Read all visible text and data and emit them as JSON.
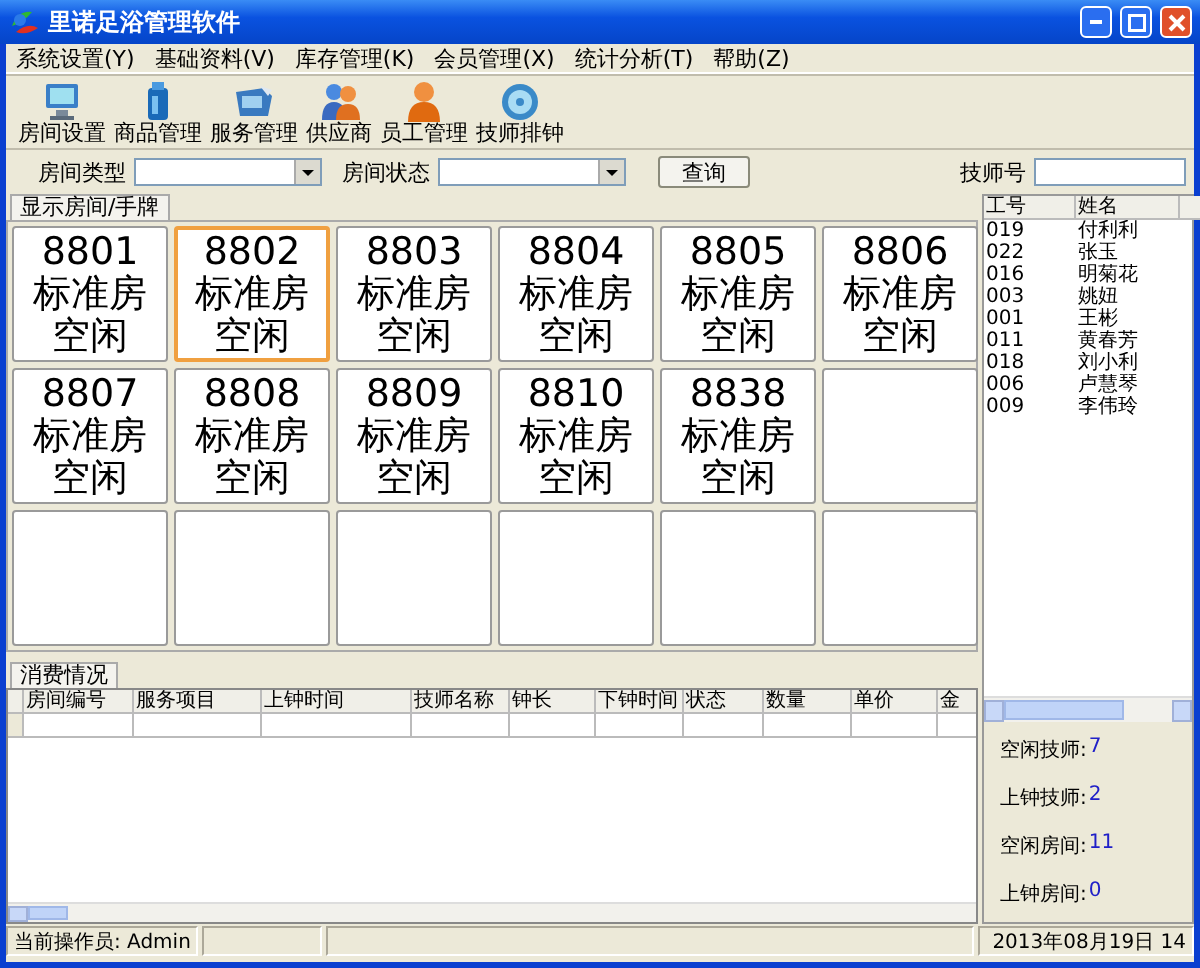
{
  "window": {
    "title": "里诺足浴管理软件"
  },
  "menu": [
    "系统设置(Y)",
    "基础资料(V)",
    "库存管理(K)",
    "会员管理(X)",
    "统计分析(T)",
    "帮助(Z)"
  ],
  "toolbar": [
    {
      "label": "房间设置",
      "kind": "monitor"
    },
    {
      "label": "商品管理",
      "kind": "bottle"
    },
    {
      "label": "服务管理",
      "kind": "tray"
    },
    {
      "label": "供应商",
      "kind": "people"
    },
    {
      "label": "员工管理",
      "kind": "person"
    },
    {
      "label": "技师排钟",
      "kind": "disc"
    }
  ],
  "filters": {
    "room_type_label": "房间类型",
    "room_status_label": "房间状态",
    "query_button": "查询",
    "tech_no_label": "技师号"
  },
  "room_tab": "显示房间/手牌",
  "rooms": [
    {
      "kind": "room",
      "number": "8801",
      "type": "标准房",
      "status": "空闲",
      "selected": false
    },
    {
      "kind": "room",
      "number": "8802",
      "type": "标准房",
      "status": "空闲",
      "selected": true
    },
    {
      "kind": "room",
      "number": "8803",
      "type": "标准房",
      "status": "空闲",
      "selected": false
    },
    {
      "kind": "room",
      "number": "8804",
      "type": "标准房",
      "status": "空闲",
      "selected": false
    },
    {
      "kind": "room",
      "number": "8805",
      "type": "标准房",
      "status": "空闲",
      "selected": false
    },
    {
      "kind": "room",
      "number": "8806",
      "type": "标准房",
      "status": "空闲",
      "selected": false
    },
    {
      "kind": "room",
      "number": "8807",
      "type": "标准房",
      "status": "空闲",
      "selected": false
    },
    {
      "kind": "room",
      "number": "8808",
      "type": "标准房",
      "status": "空闲",
      "selected": false
    },
    {
      "kind": "room",
      "number": "8809",
      "type": "标准房",
      "status": "空闲",
      "selected": false
    },
    {
      "kind": "room",
      "number": "8810",
      "type": "标准房",
      "status": "空闲",
      "selected": false
    },
    {
      "kind": "room",
      "number": "8838",
      "type": "标准房",
      "status": "空闲",
      "selected": false
    },
    {
      "kind": "empty"
    },
    {
      "kind": "empty"
    },
    {
      "kind": "empty"
    },
    {
      "kind": "empty"
    },
    {
      "kind": "empty"
    },
    {
      "kind": "empty"
    },
    {
      "kind": "empty"
    }
  ],
  "consumption": {
    "tab": "消费情况",
    "columns": [
      "房间编号",
      "服务项目",
      "上钟时间",
      "技师名称",
      "钟长",
      "下钟时间",
      "状态",
      "数量",
      "单价",
      "金"
    ]
  },
  "technicians": {
    "columns": [
      "工号",
      "姓名"
    ],
    "rows": [
      {
        "id": "019",
        "name": "付利利"
      },
      {
        "id": "022",
        "name": "张玉"
      },
      {
        "id": "016",
        "name": "明菊花"
      },
      {
        "id": "003",
        "name": "姚妞"
      },
      {
        "id": "001",
        "name": "王彬"
      },
      {
        "id": "011",
        "name": "黄春芳"
      },
      {
        "id": "018",
        "name": "刘小利"
      },
      {
        "id": "006",
        "name": "卢慧琴"
      },
      {
        "id": "009",
        "name": "李伟玲"
      }
    ]
  },
  "stats": [
    {
      "label": "空闲技师:",
      "value": "7"
    },
    {
      "label": "上钟技师:",
      "value": "2"
    },
    {
      "label": "空闲房间:",
      "value": "11"
    },
    {
      "label": "上钟房间:",
      "value": "0"
    }
  ],
  "status_bar": {
    "operator": "当前操作员: Admin",
    "datetime": "2013年08月19日 14"
  }
}
